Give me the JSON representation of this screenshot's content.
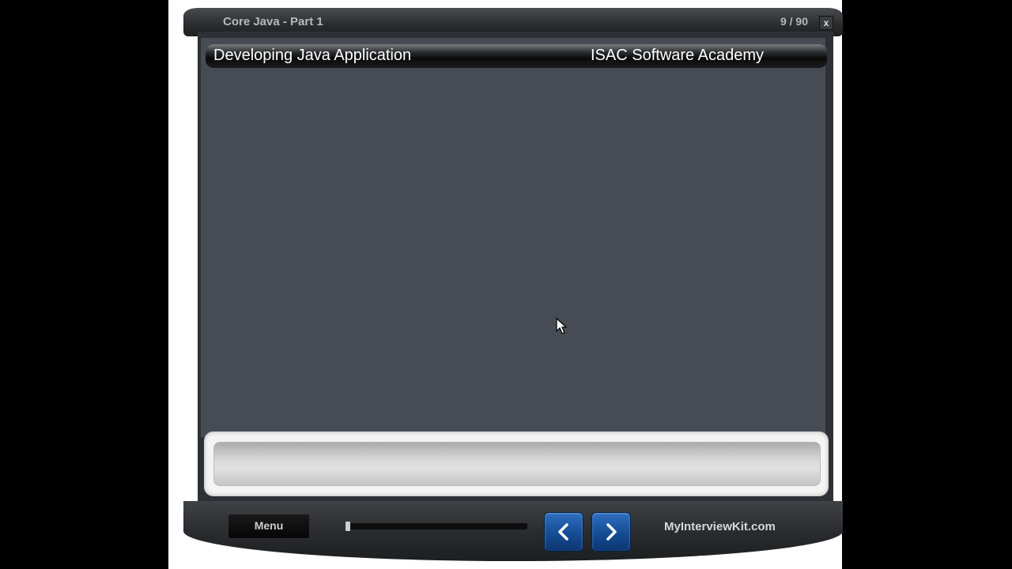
{
  "window": {
    "title": "Core Java - Part 1",
    "slide_counter": "9 / 90",
    "close_label": "x"
  },
  "slide": {
    "header_left": "Developing Java Application",
    "header_right": "ISAC Software Academy"
  },
  "controls": {
    "menu_label": "Menu",
    "progress": 0.0,
    "brand": "MyInterviewKit.com"
  },
  "icons": {
    "prev": "chevron-left-icon",
    "next": "chevron-right-icon",
    "cursor": "mouse-cursor-icon"
  },
  "colors": {
    "slide_bg": "#474c54",
    "nav_button": "#1f5aa8"
  }
}
